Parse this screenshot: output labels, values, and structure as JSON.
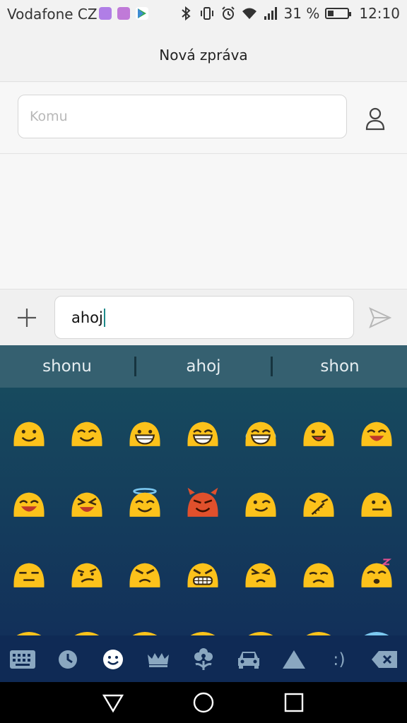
{
  "status_bar": {
    "carrier": "Vodafone CZ",
    "battery_percent": "31 %",
    "battery_level": 0.31,
    "time": "12:10",
    "icons": [
      "keyboard-app-icon",
      "gallery-app-icon",
      "play-store-icon",
      "bluetooth-icon",
      "vibrate-icon",
      "alarm-icon",
      "wifi-icon",
      "signal-icon",
      "battery-icon"
    ]
  },
  "header": {
    "title": "Nová zpráva"
  },
  "recipient": {
    "placeholder": "Komu",
    "contact_icon": "person-icon"
  },
  "compose": {
    "add_icon": "plus-icon",
    "text": "ahoj",
    "send_icon": "send-icon"
  },
  "suggestions": [
    "shonu",
    "ahoj",
    "shon"
  ],
  "emoji_rows": [
    [
      "slightly-smiling",
      "smiling-blush",
      "grinning",
      "grinning-big",
      "tears-of-joy",
      "open-mouth-smile",
      "laughing-blush"
    ],
    [
      "sweat-smile",
      "squinting-laugh",
      "halo-smile",
      "smiling-devil",
      "wink",
      "zipper-worried",
      "side-glance"
    ],
    [
      "expressionless",
      "confused",
      "angry",
      "grimacing",
      "pouting",
      "sad-drooping",
      "sleeping"
    ]
  ],
  "keyboard_toolbar": [
    "keyboard-icon",
    "recent-clock-icon",
    "smiley-icon",
    "crown-icon",
    "flower-icon",
    "car-icon",
    "triangle-symbol-icon",
    "emoticon-text-icon",
    "backspace-icon"
  ],
  "emoticon_label": ":)",
  "nav": [
    "back-icon",
    "home-icon",
    "recents-icon"
  ],
  "colors": {
    "emoji_yellow": "#fcc21b",
    "devil_red": "#e0502c",
    "accent_teal": "#356070",
    "keyboard_bar": "#0f2a55"
  }
}
